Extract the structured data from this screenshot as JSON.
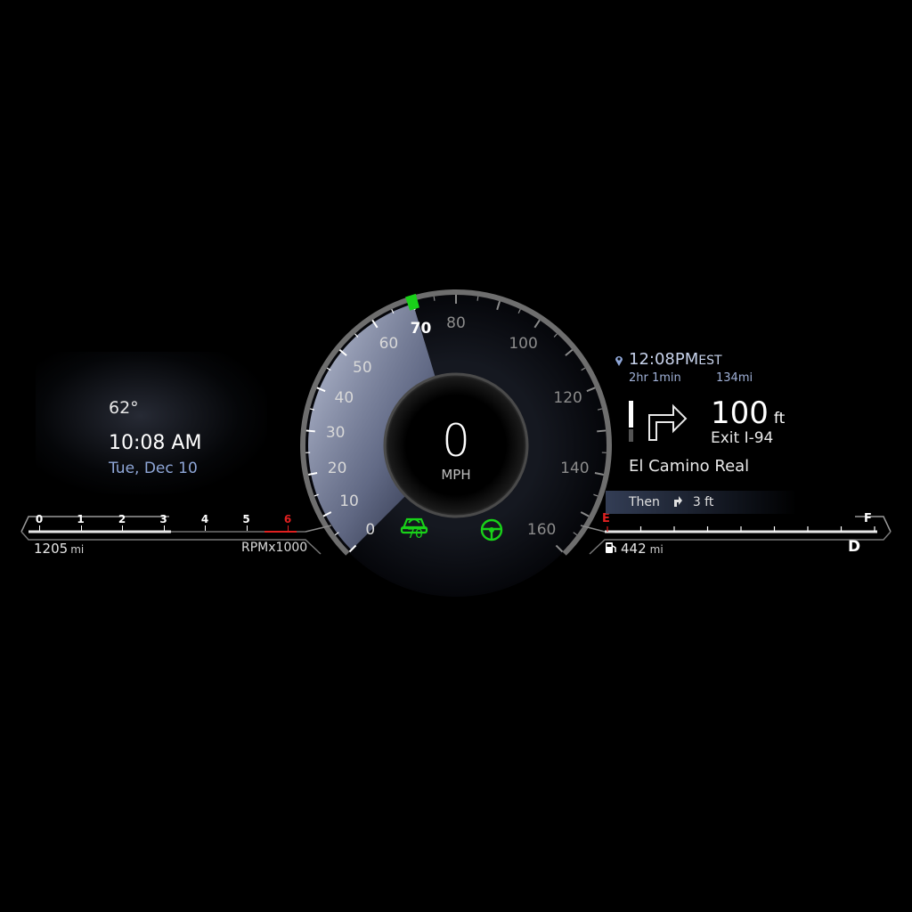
{
  "weather": {
    "temperature": "62°"
  },
  "clock": {
    "time": "10:08 AM",
    "date": "Tue, Dec 10"
  },
  "tachometer": {
    "ticks": [
      "0",
      "1",
      "2",
      "3",
      "4",
      "5",
      "6"
    ],
    "redline_tick": "6",
    "label": "RPMx1000",
    "current_rpm_x1000": 3
  },
  "odometer": {
    "value": "1205",
    "unit": "mi"
  },
  "speedometer": {
    "speed": "0",
    "unit": "MPH",
    "scale": [
      "0",
      "10",
      "20",
      "30",
      "40",
      "50",
      "60",
      "70",
      "80",
      "100",
      "120",
      "140",
      "160"
    ],
    "set_speed_marker": 70
  },
  "indicators": {
    "cruise_set_speed": "70",
    "cruise_icon": "adaptive-cruise-icon",
    "steering_icon": "steering-assist-icon",
    "active_color": "#19d119"
  },
  "navigation": {
    "pin_icon": "location-pin-icon",
    "eta_time": "12:08PM",
    "eta_zone": "EST",
    "duration": "2hr 1min",
    "distance": "134mi",
    "turn_icon": "turn-right-arrow-icon",
    "maneuver_distance": "100",
    "maneuver_unit": "ft",
    "exit": "Exit I-94",
    "street": "El Camino Real",
    "then_label": "Then",
    "then_icon": "turn-right-small-icon",
    "then_distance": "3 ft"
  },
  "fuel": {
    "empty_label": "E",
    "full_label": "F",
    "range": "442",
    "range_unit": "mi",
    "pump_icon": "fuel-pump-icon",
    "level": 1.0
  },
  "transmission": {
    "gear": "D"
  },
  "colors": {
    "accent_blue": "#8fa7d8",
    "green": "#19d119",
    "redline": "#e02020"
  }
}
